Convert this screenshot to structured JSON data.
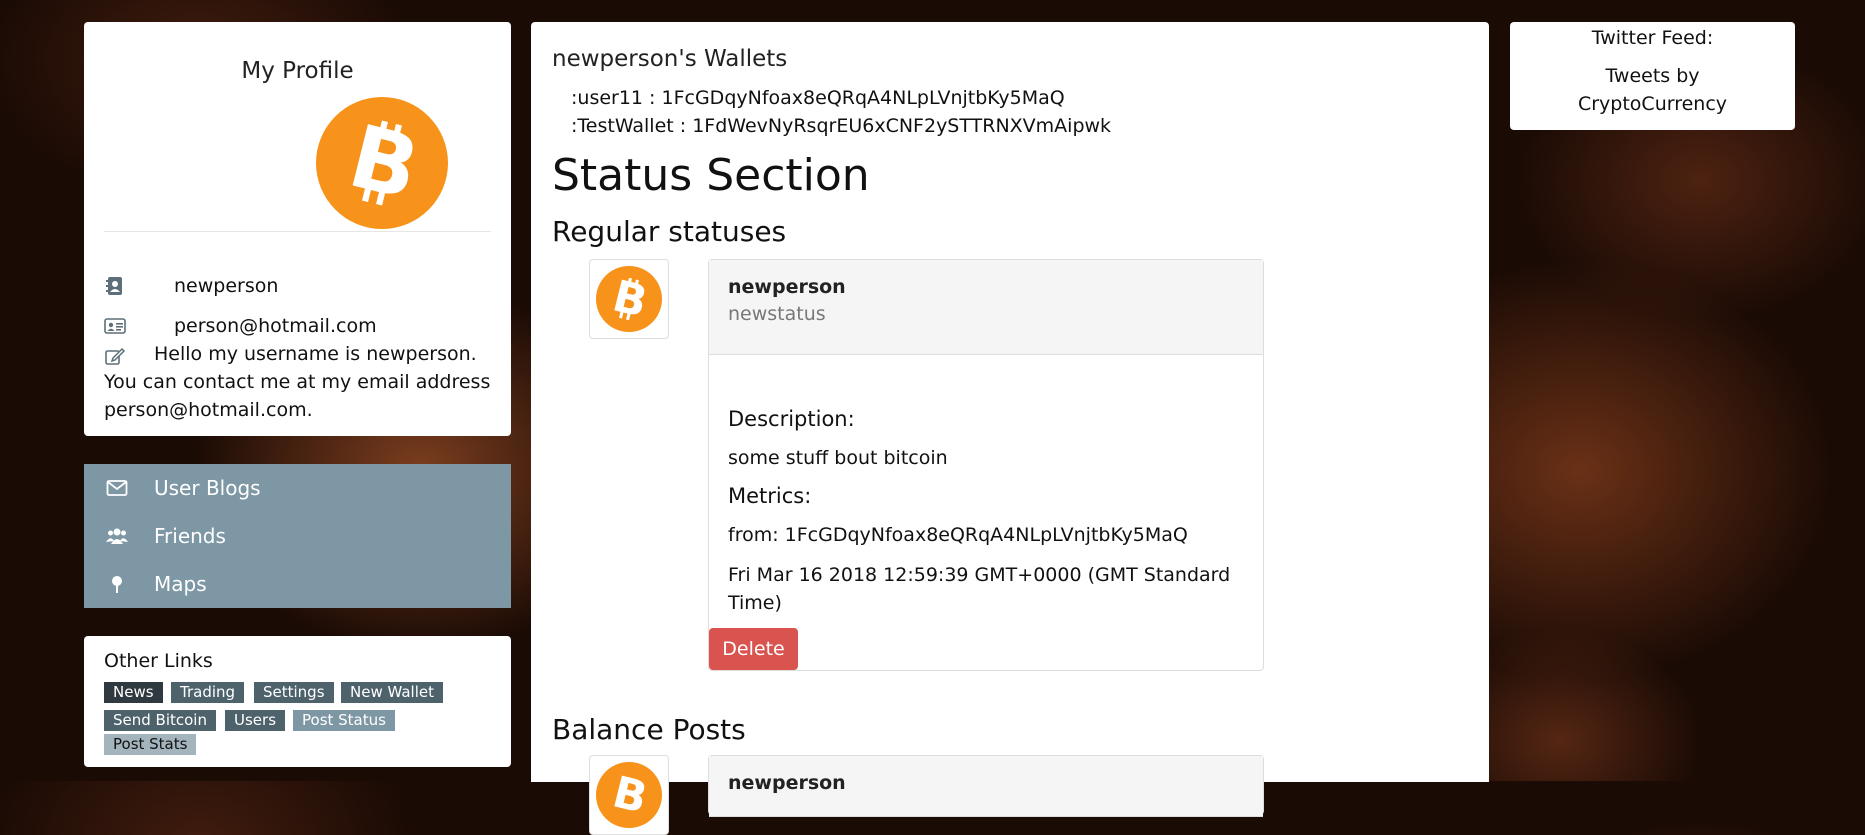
{
  "profile": {
    "title": "My Profile",
    "logo_icon": "bitcoin-logo",
    "username": "newperson",
    "email": "person@hotmail.com",
    "about": "Hello my username is newperson. You can contact me at my email address person@hotmail.com."
  },
  "nav": {
    "items": [
      {
        "label": "User Blogs",
        "icon": "envelope-icon"
      },
      {
        "label": "Friends",
        "icon": "users-icon"
      },
      {
        "label": "Maps",
        "icon": "map-pin-icon"
      }
    ]
  },
  "other_links": {
    "title": "Other Links",
    "tags": [
      "News",
      "Trading",
      "Settings",
      "New Wallet",
      "Send Bitcoin",
      "Users",
      "Post Status",
      "Post Stats"
    ]
  },
  "wallets": {
    "title": "newperson's Wallets",
    "items": [
      ":user11 : 1FcGDqyNfoax8eQRqA4NLpLVnjtbKy5MaQ",
      ":TestWallet : 1FdWevNyRsqrEU6xCNF2ySTTRNXVmAipwk"
    ]
  },
  "status_section": {
    "title": "Status Section",
    "regular_title": "Regular statuses",
    "post": {
      "author": "newperson",
      "status": "newstatus",
      "description_label": "Description:",
      "description": "some stuff bout bitcoin",
      "metrics_label": "Metrics:",
      "from": "from: 1FcGDqyNfoax8eQRqA4NLpLVnjtbKy5MaQ",
      "date_line1": "Fri Mar 16 2018 12:59:39 GMT+0000 (GMT Standard",
      "date_line2": "Time)",
      "delete_label": "Delete"
    },
    "balance_title": "Balance Posts",
    "balance_post": {
      "author": "newperson"
    }
  },
  "twitter": {
    "title": "Twitter Feed:",
    "link": "Tweets by CryptoCurrency"
  },
  "colors": {
    "bitcoin_orange": "#f7931a",
    "nav_bg": "#7e97a4",
    "delete_red": "#d9534f"
  }
}
